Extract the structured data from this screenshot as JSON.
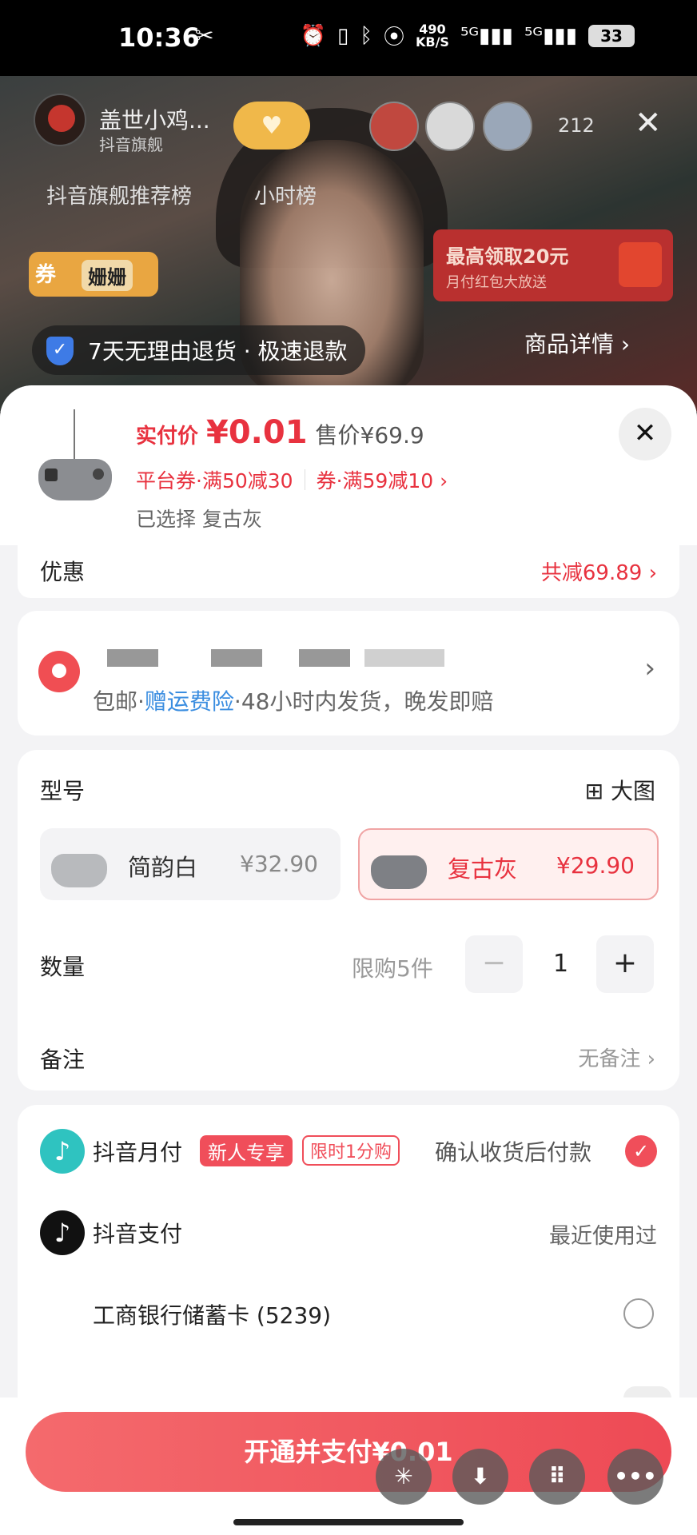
{
  "status_bar": {
    "time": "10:36",
    "net_speed_value": "490",
    "net_speed_unit": "KB/S",
    "battery": "33"
  },
  "live": {
    "shop_name": "盖世小鸡...",
    "shop_sub": "抖音旗舰",
    "viewer_count": "212",
    "tabs": [
      "抖音旗舰推荐榜",
      "小时榜"
    ],
    "coupon_tag": "券",
    "host_name": "姗姗",
    "promo_title": "最高领取20元",
    "promo_sub": "月付红包大放送",
    "guarantee": "7天无理由退货 · 极速退款",
    "detail_button": "商品详情 ›"
  },
  "product": {
    "price_label": "实付价",
    "price": "¥0.01",
    "original_price": "售价¥69.9",
    "coupon_platform": "平台券·满50减30",
    "coupon_shop": "券·满59减10 ›",
    "selected_label": "已选择 复古灰"
  },
  "discount": {
    "label": "优惠",
    "value": "共减69.89 ›"
  },
  "shipping": {
    "free": "包邮·",
    "insurance": "赠运费险",
    "promise": "·48小时内发货，晚发即赔"
  },
  "spec": {
    "label": "型号",
    "big_image": "大图",
    "variants": [
      {
        "name": "简韵白",
        "price": "¥32.90",
        "selected": false
      },
      {
        "name": "复古灰",
        "price": "¥29.90",
        "selected": true
      }
    ],
    "quantity_label": "数量",
    "limit": "限购5件",
    "quantity": "1",
    "minus": "−",
    "plus": "+",
    "note_label": "备注",
    "note_value": "无备注 ›"
  },
  "payment": {
    "monthly_label": "抖音月付",
    "badge_new": "新人专享",
    "badge_limit": "限时1分购",
    "monthly_note": "确认收货后付款",
    "douyin_pay_label": "抖音支付",
    "douyin_pay_note": "最近使用过",
    "bank_card": "工商银行储蓄卡 (5239)"
  },
  "cta": {
    "pay_button": "开通并支付¥0.01"
  },
  "colors": {
    "accent_red": "#e8323f",
    "link_blue": "#3a8de0",
    "monthly_teal": "#2fc3c0"
  }
}
